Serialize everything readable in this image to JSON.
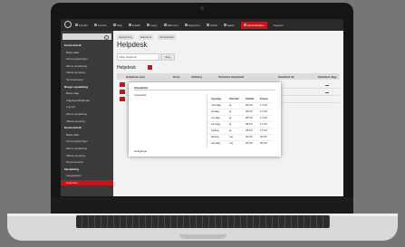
{
  "nav": {
    "items": [
      "Forside",
      "Kunder",
      "Salg",
      "Indkøb",
      "Lager",
      "Økonomi",
      "Rapporter",
      "Indstil",
      "Hjælp",
      "Administration",
      "Opgaver"
    ]
  },
  "sidebar": {
    "search_placeholder": "",
    "items": [
      {
        "label": "Konto-indstil",
        "group": true
      },
      {
        "label": "Basis data",
        "group": false
      },
      {
        "label": "Firma oplysninger",
        "group": false
      },
      {
        "label": "Moms opsætning",
        "group": false
      },
      {
        "label": "Valuta og sprog",
        "group": false
      },
      {
        "label": "Nummerserier",
        "group": false
      },
      {
        "label": "Bruger opsætning",
        "group": true
      },
      {
        "label": "Basis data",
        "group": false
      },
      {
        "label": "Adgangsrettigheder",
        "group": false
      },
      {
        "label": "Log ind",
        "group": false
      },
      {
        "label": "Moms opsætning",
        "group": false
      },
      {
        "label": "Valuta og sprog",
        "group": false
      },
      {
        "label": "Konto-indstil",
        "group": true
      },
      {
        "label": "Basis data",
        "group": false
      },
      {
        "label": "Firma oplysninger",
        "group": false
      },
      {
        "label": "Moms opsætning",
        "group": false
      },
      {
        "label": "Valuta og sprog",
        "group": false
      },
      {
        "label": "Nummerserier",
        "group": false
      },
      {
        "label": "Opsætning",
        "group": true
      },
      {
        "label": "Integrationer",
        "group": false
      },
      {
        "label": "Helpdesk",
        "group": false
      }
    ],
    "active_label": "Helpdesk"
  },
  "breadcrumb": [
    "Opsætning",
    "Helpdesk",
    "Arbejdstider"
  ],
  "page_title": "Helpdesk",
  "filter_value": "Vælg helpdesk",
  "filter_button": "Søg",
  "section_title": "Helpdesk",
  "table_headers": [
    "Helpdesk navn",
    "Kode",
    "Afdeling",
    "Standard arbejdstid",
    "Standard tid",
    "Standard dage"
  ],
  "popup": {
    "title": "Arbejdstid",
    "label": "Arbejdstid",
    "footer": "Helligdage",
    "col_headers": [
      "Ugedag",
      "Starttid",
      "Sluttid",
      "Pause"
    ],
    "rows": [
      [
        "mandag",
        "ja",
        "08:00",
        "17:00"
      ],
      [
        "tirsdag",
        "ja",
        "08:00",
        "17:00"
      ],
      [
        "onsdag",
        "ja",
        "08:00",
        "17:00"
      ],
      [
        "torsdag",
        "ja",
        "08:00",
        "17:00"
      ],
      [
        "fredag",
        "ja",
        "08:00",
        "17:00"
      ],
      [
        "lørdag",
        "nej",
        "00:00",
        "00:00"
      ],
      [
        "søndag",
        "nej",
        "00:00",
        "00:00"
      ]
    ]
  },
  "colors": {
    "accent": "#c0171c",
    "sidebar": "#3a3a3a",
    "nav": "#2a2a2a"
  }
}
